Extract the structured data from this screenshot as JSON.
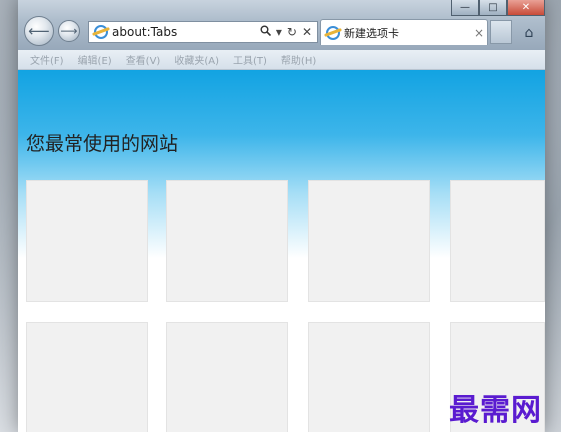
{
  "browser": {
    "address": {
      "value": "about:Tabs",
      "search_icon": "magnifier-icon",
      "dropdown_glyph": "▾",
      "refresh_glyph": "↻",
      "stop_glyph": "✕"
    },
    "active_tab": {
      "label": "新建选项卡",
      "close_glyph": "×"
    },
    "window_controls": {
      "minimize": "—",
      "maximize": "□",
      "close": "✕"
    },
    "home_glyph": "⌂",
    "back_glyph": "⟵",
    "forward_glyph": "⟶"
  },
  "menubar": {
    "items": [
      "文件(F)",
      "编辑(E)",
      "查看(V)",
      "收藏夹(A)",
      "工具(T)",
      "帮助(H)"
    ]
  },
  "page": {
    "heading": "您最常使用的网站",
    "tile_count_visible": 8,
    "gradient_top_color": "#12a3e2"
  },
  "watermark": "最需网"
}
